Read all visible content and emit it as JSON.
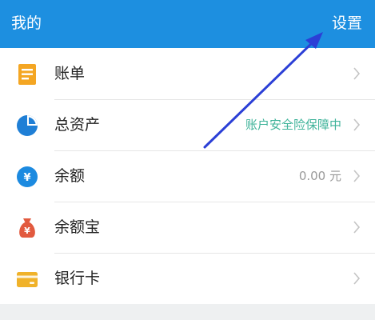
{
  "header": {
    "title": "我的",
    "settings_label": "设置",
    "background": "#1d8fe0"
  },
  "rows": [
    {
      "label": "账单",
      "icon": "bill-icon",
      "value": "",
      "value_color": ""
    },
    {
      "label": "总资产",
      "icon": "pie-chart-icon",
      "value": "账户安全险保障中",
      "value_color": "#3fb39a"
    },
    {
      "label": "余额",
      "icon": "yuan-coin-icon",
      "value": "0.00 元",
      "value_color": "#999999"
    },
    {
      "label": "余额宝",
      "icon": "money-bag-icon",
      "value": "",
      "value_color": ""
    },
    {
      "label": "银行卡",
      "icon": "bank-card-icon",
      "value": "",
      "value_color": ""
    }
  ],
  "icons": {
    "yuan_glyph": "¥"
  },
  "annotation": {
    "arrow_color": "#2b3fd6"
  }
}
